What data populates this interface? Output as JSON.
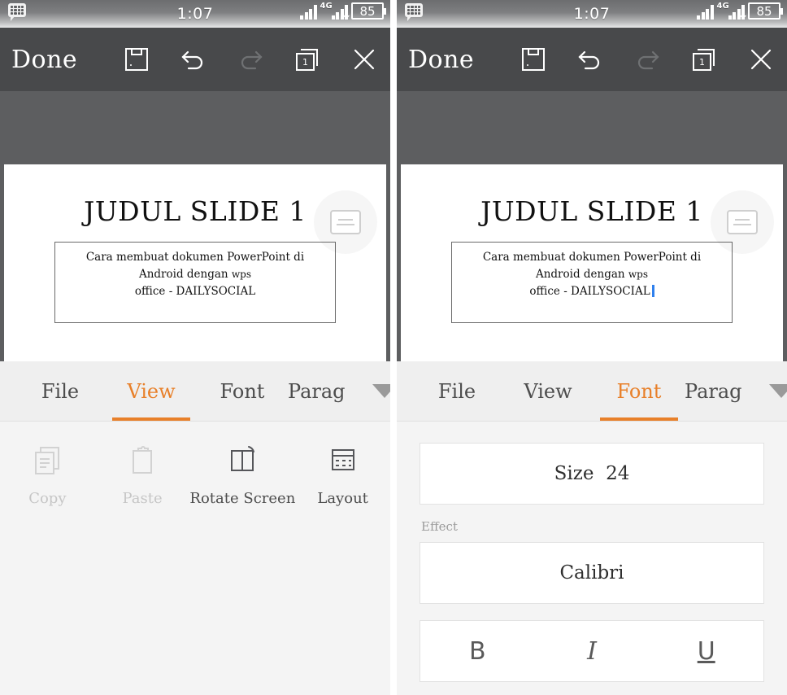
{
  "status_bar": {
    "notification_icon": "bbm-message-icon",
    "time": "1:07",
    "network_type": "4G",
    "battery_level": "85"
  },
  "toolbar": {
    "done_label": "Done",
    "icons": [
      {
        "name": "save-icon"
      },
      {
        "name": "undo-icon"
      },
      {
        "name": "redo-icon"
      },
      {
        "name": "slides-icon",
        "badge": "1"
      },
      {
        "name": "close-icon"
      }
    ]
  },
  "slide": {
    "title": "JUDUL SLIDE 1",
    "body_line1": "Cara membuat dokumen PowerPoint di Android dengan ",
    "body_line1_small": "wps",
    "body_line2": "office - DAILYSOCIAL",
    "comment_icon": "text-box-icon"
  },
  "tabs": {
    "items": [
      "File",
      "View",
      "Font",
      "Parag"
    ],
    "left_active": "View",
    "right_active": "Font",
    "more_icon": "chevron-down-icon",
    "accent_color": "#e8802a"
  },
  "view_panel": {
    "tools": [
      {
        "label": "Copy",
        "icon": "copy-icon",
        "disabled": true
      },
      {
        "label": "Paste",
        "icon": "paste-icon",
        "disabled": true
      },
      {
        "label": "Rotate Screen",
        "icon": "rotate-screen-icon",
        "disabled": false
      },
      {
        "label": "Layout",
        "icon": "layout-icon",
        "disabled": false
      }
    ]
  },
  "font_panel": {
    "size_label": "Size",
    "size_value": "24",
    "effect_label": "Effect",
    "font_name": "Calibri",
    "style_buttons": [
      {
        "label": "B",
        "name": "bold-button"
      },
      {
        "label": "I",
        "name": "italic-button"
      },
      {
        "label": "U",
        "name": "underline-button"
      }
    ]
  }
}
